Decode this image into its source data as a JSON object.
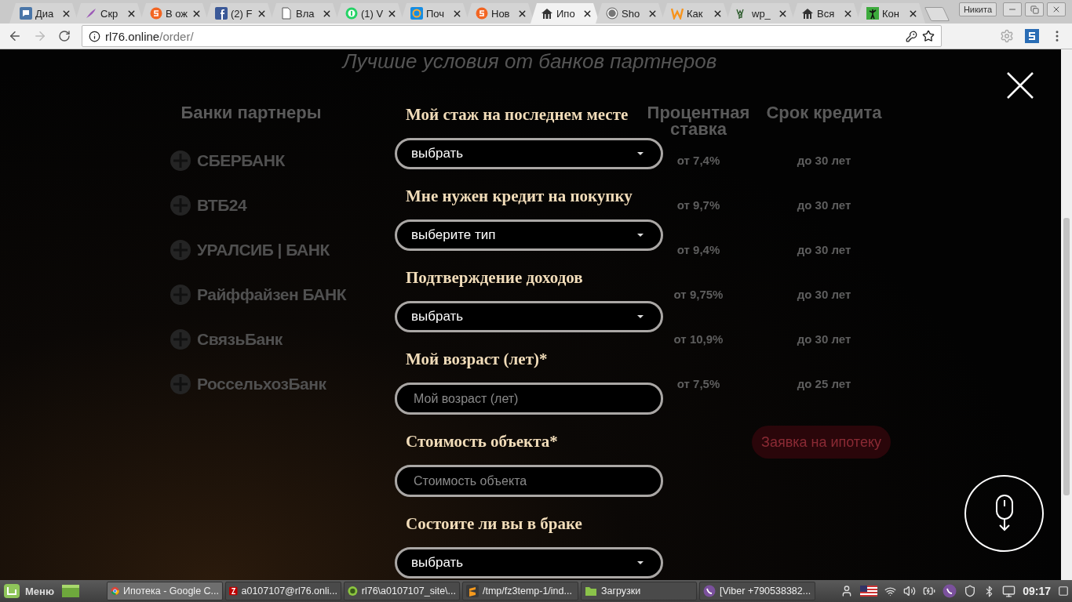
{
  "browser": {
    "tabs": [
      {
        "title": "Диа",
        "kind": "chat",
        "selected": false
      },
      {
        "title": "Скр",
        "kind": "feather",
        "selected": false
      },
      {
        "title": "В ож",
        "kind": "s",
        "selected": false
      },
      {
        "title": "(2) F",
        "kind": "facebook",
        "selected": false
      },
      {
        "title": "Вла",
        "kind": "page",
        "selected": false
      },
      {
        "title": "(1) V",
        "kind": "whatsapp",
        "selected": false
      },
      {
        "title": "Поч",
        "kind": "mail",
        "selected": false
      },
      {
        "title": "Нов",
        "kind": "s",
        "selected": false
      },
      {
        "title": "Ипо",
        "kind": "house",
        "selected": true
      },
      {
        "title": "Sho",
        "kind": "wordpress",
        "selected": false
      },
      {
        "title": "Как",
        "kind": "w",
        "selected": false
      },
      {
        "title": "wp_",
        "kind": "wp",
        "selected": false
      },
      {
        "title": "Вся",
        "kind": "house",
        "selected": false
      },
      {
        "title": "Кон",
        "kind": "figure",
        "selected": false
      }
    ],
    "profile": "Никита",
    "address": {
      "host": "rl76.online",
      "path": "/order/"
    }
  },
  "page": {
    "heading": "Лучшие условия от банков партнеров",
    "columns": [
      "Банки партнеры",
      "Процентная ставка",
      "Срок кредита"
    ],
    "rows": [
      {
        "bank": "СБЕРБАНК",
        "rate": "от 7,4%",
        "term": "до 30 лет"
      },
      {
        "bank": "ВТБ24",
        "rate": "от 9,7%",
        "term": "до 30 лет"
      },
      {
        "bank": "УРАЛСИБ | БАНК",
        "rate": "от 9,4%",
        "term": "до 30 лет"
      },
      {
        "bank": "Райффайзен БАНК",
        "rate": "от 9,75%",
        "term": "до 30 лет"
      },
      {
        "bank": "СвязьБанк",
        "rate": "от 10,9%",
        "term": "до 30 лет"
      },
      {
        "bank": "РоссельхозБанк",
        "rate": "от 7,5%",
        "term": "до 25 лет"
      }
    ],
    "request_button": "Заявка на ипотеку",
    "form": [
      {
        "label": "Мой стаж на последнем месте",
        "kind": "select",
        "value": "выбрать"
      },
      {
        "label": "Мне нужен кредит на покупку",
        "kind": "select",
        "value": "выберите тип"
      },
      {
        "label": "Подтверждение доходов",
        "kind": "select",
        "value": "выбрать"
      },
      {
        "label": "Мой возраст (лет)*",
        "kind": "input",
        "placeholder": "Мой возраст (лет)"
      },
      {
        "label": "Стоимость объекта*",
        "kind": "input",
        "placeholder": "Стоимость объекта"
      },
      {
        "label": "Состоите ли вы в браке",
        "kind": "select",
        "value": "выбрать"
      }
    ]
  },
  "taskbar": {
    "menu": "Меню",
    "windows": [
      {
        "title": "Ипотека - Google C...",
        "kind": "chrome",
        "selected": true
      },
      {
        "title": "a0107107@rl76.onli...",
        "kind": "filezilla",
        "selected": false
      },
      {
        "title": "rl76\\a0107107_site\\...",
        "kind": "hs",
        "selected": false
      },
      {
        "title": "/tmp/fz3temp-1/ind...",
        "kind": "sublime",
        "selected": false
      },
      {
        "title": "Загрузки",
        "kind": "folder",
        "selected": false
      },
      {
        "title": "[Viber +790538382...",
        "kind": "viber",
        "selected": false
      }
    ],
    "clock": "09:17"
  }
}
